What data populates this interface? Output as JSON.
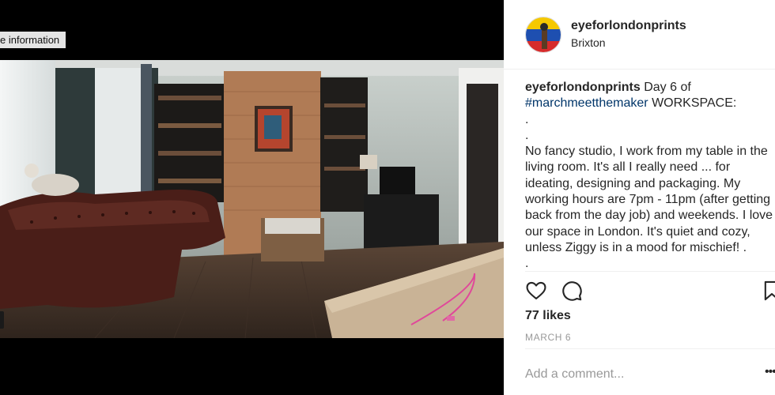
{
  "media": {
    "info_label": "e information"
  },
  "post": {
    "username": "eyeforlondonprints",
    "location": "Brixton",
    "caption": {
      "username": "eyeforlondonprints",
      "line1_text": " Day 6 of",
      "hashtag": "#marchmeetthemaker",
      "hashtag_suffix": " WORKSPACE:",
      "dot1": ".",
      "dot2": ".",
      "body_lines": [
        "No fancy studio, I work from my table in the",
        "living room. It's all I really need ... for",
        "ideating, designing and packaging. My",
        "working hours are 7pm - 11pm (after getting",
        "back from the day job) and weekends. I love",
        "our space in London. It's quiet and cozy,",
        "unless Ziggy is in a mood for mischief! ."
      ],
      "dot3": "."
    },
    "likes": "77 likes",
    "date": "MARCH 6",
    "comment_placeholder": "Add a comment...",
    "more_label": "•••"
  },
  "icons": {
    "like": "heart-icon",
    "comment": "comment-bubble-icon",
    "save": "bookmark-icon",
    "more": "more-options-icon"
  }
}
